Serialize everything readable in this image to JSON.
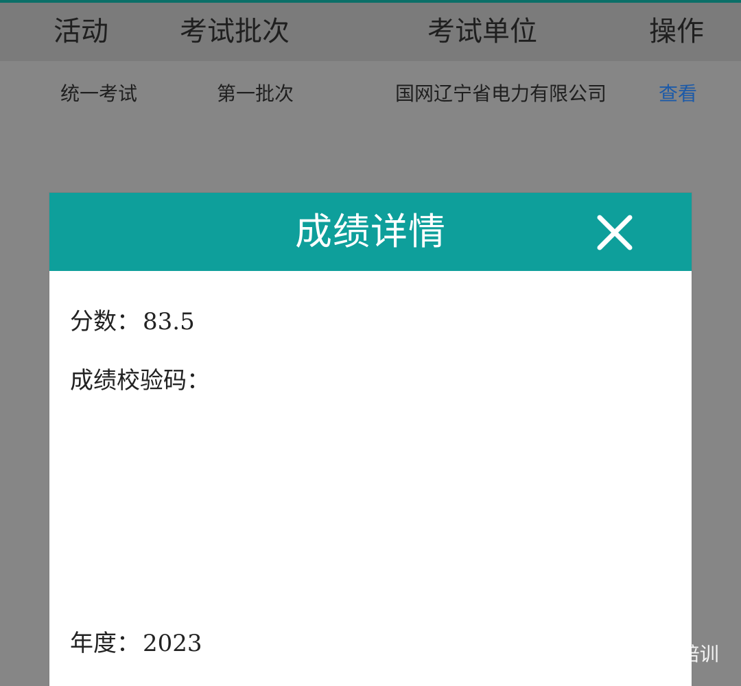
{
  "table": {
    "headers": [
      "活动",
      "考试批次",
      "考试单位",
      "操作"
    ],
    "rows": [
      {
        "activity": "统一考试",
        "batch": "第一批次",
        "unit": "国网辽宁省电力有限公司",
        "action": "查看"
      }
    ]
  },
  "modal": {
    "title": "成绩详情",
    "fields": {
      "score_label": "分数：",
      "score_value": "83.5",
      "verification_label": "成绩校验码：",
      "year_label": "年度：",
      "year_value": "2023"
    }
  },
  "watermark": {
    "text": "vivi电力培训",
    "icon": "wechat-icon"
  },
  "colors": {
    "teal_header": "#0e9f9b",
    "link_blue": "#1c5aa8",
    "overlay_gray": "#868686"
  }
}
